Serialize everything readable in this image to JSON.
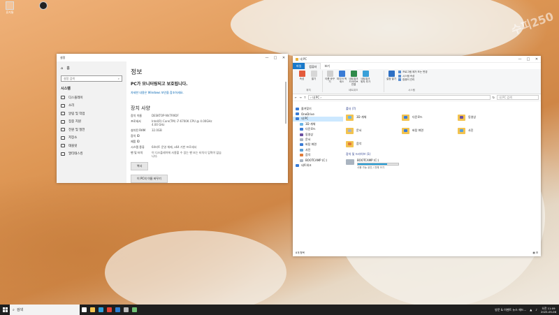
{
  "colors": {
    "accent": "#0063b1",
    "file_tab": "#1979ca",
    "folder": "#f3c34f",
    "selected_nav": "#cce8ff",
    "drive_fill": "#26a0da",
    "taskbar": "#1f1f1f"
  },
  "desktop": {
    "icons": [
      {
        "label": "휴지통",
        "icon": "recycle-bin-icon"
      },
      {
        "label": "",
        "icon": "app-shortcut-icon"
      }
    ],
    "watermark": "수피250"
  },
  "settings": {
    "window_title": "설정",
    "controls": [
      "—",
      "□",
      "✕"
    ],
    "home_label": "홈",
    "search_placeholder": "설정 검색",
    "category": "시스템",
    "nav_items": [
      {
        "label": "디스플레이",
        "icon": "display-icon"
      },
      {
        "label": "소리",
        "icon": "sound-icon"
      },
      {
        "label": "알림 및 작업",
        "icon": "notification-icon"
      },
      {
        "label": "집중 지원",
        "icon": "focus-assist-icon"
      },
      {
        "label": "전원 및 절전",
        "icon": "power-icon"
      },
      {
        "label": "저장소",
        "icon": "storage-icon"
      },
      {
        "label": "태블릿",
        "icon": "tablet-icon"
      },
      {
        "label": "멀티태스킹",
        "icon": "multitasking-icon"
      }
    ],
    "page_title": "정보",
    "protect_status": "PC가 모니터링되고 보호됩니다.",
    "security_link": "자세한 내용은 Windows 보안을 참조하세요.",
    "device_heading": "장치 사양",
    "specs": [
      {
        "key": "장치 이름",
        "value": "DESKTOP-NV7R9DF"
      },
      {
        "key": "프로세서",
        "value": "Intel(R) Core(TM) i7-6700K CPU @ 4.00GHz   4.00 GHz"
      },
      {
        "key": "설치된 RAM",
        "value": "32.0GB"
      },
      {
        "key": "장치 ID",
        "value": ""
      },
      {
        "key": "제품 ID",
        "value": ""
      },
      {
        "key": "시스템 종류",
        "value": "64비트 운영 체제, x64 기반 프로세서"
      },
      {
        "key": "펜 및 터치",
        "value": "이 디스플레이에 사용할 수 있는 펜 또는 터치식 입력이 없습니다."
      }
    ],
    "copy_button": "복사",
    "rename_button": "이 PC의 이름 바꾸기"
  },
  "explorer": {
    "window_title": "내 PC",
    "controls": [
      "—",
      "□",
      "✕"
    ],
    "tabs": [
      "파일",
      "컴퓨터",
      "보기"
    ],
    "ribbon": {
      "groups": [
        {
          "label": "위치",
          "buttons": [
            {
              "label": "속성",
              "icon": "properties-icon"
            },
            {
              "label": "열기",
              "icon": "open-icon"
            },
            {
              "label": "이름 바꾸기",
              "icon": "rename-icon"
            },
            {
              "label": "미디어 액세스",
              "icon": "media-access-icon"
            },
            {
              "label": "네트워크 드라이브 연결",
              "icon": "map-network-drive-icon"
            },
            {
              "label": "네트워크 위치 추가",
              "icon": "add-network-location-icon"
            }
          ]
        },
        {
          "label": "네트워크",
          "buttons": []
        },
        {
          "label": "시스템",
          "buttons": [
            {
              "label": "설정 열기",
              "icon": "open-settings-icon"
            }
          ]
        }
      ],
      "system_list": [
        "프로그램 제거 또는 변경",
        "시스템 속성",
        "컴퓨터 관리"
      ]
    },
    "address": "› 내 PC ›",
    "search_placeholder": "내 PC 검색",
    "nav": [
      {
        "label": "즐겨찾기",
        "icon": "star-icon",
        "color": "#3a7bd5",
        "sub": false,
        "selected": false
      },
      {
        "label": "OneDrive",
        "icon": "cloud-icon",
        "color": "#3a7bd5",
        "sub": false,
        "selected": false
      },
      {
        "label": "내 PC",
        "icon": "pc-icon",
        "color": "#3a7bd5",
        "sub": false,
        "selected": true
      },
      {
        "label": "3D 개체",
        "icon": "3d-objects-icon",
        "color": "#6cb6e8",
        "sub": true,
        "selected": false
      },
      {
        "label": "다운로드",
        "icon": "download-icon",
        "color": "#3a7bd5",
        "sub": true,
        "selected": false
      },
      {
        "label": "동영상",
        "icon": "video-icon",
        "color": "#6b4fa0",
        "sub": true,
        "selected": false
      },
      {
        "label": "문서",
        "icon": "document-icon",
        "color": "#aab4c0",
        "sub": true,
        "selected": false
      },
      {
        "label": "바탕 화면",
        "icon": "desktop-icon",
        "color": "#3a7bd5",
        "sub": true,
        "selected": false
      },
      {
        "label": "사진",
        "icon": "pictures-icon",
        "color": "#5aa0d8",
        "sub": true,
        "selected": false
      },
      {
        "label": "음악",
        "icon": "music-icon",
        "color": "#e07b39",
        "sub": true,
        "selected": false
      },
      {
        "label": "BOOTCAMP (C:)",
        "icon": "drive-icon",
        "color": "#aab4c0",
        "sub": true,
        "selected": false
      },
      {
        "label": "네트워크",
        "icon": "network-icon",
        "color": "#3a7bd5",
        "sub": false,
        "selected": false
      }
    ],
    "folders_header": "폴더 (7)",
    "folders": [
      {
        "label": "3D 개체",
        "overlay": "#6cb6e8"
      },
      {
        "label": "다운로드",
        "overlay": "#3a7bd5"
      },
      {
        "label": "동영상",
        "overlay": "#6b4fa0"
      },
      {
        "label": "문서",
        "overlay": "#aab4c0"
      },
      {
        "label": "바탕 화면",
        "overlay": "#3a7bd5"
      },
      {
        "label": "사진",
        "overlay": "#5aa0d8"
      },
      {
        "label": "음악",
        "overlay": "#e07b39"
      }
    ],
    "drives_header": "장치 및 드라이브 (1)",
    "drive": {
      "name": "BOOTCAMP (C:)",
      "used_fraction": 0.72,
      "free_text": "사용 가능 공간 / 전체 크기"
    },
    "status": "8개 항목"
  },
  "taskbar": {
    "search_placeholder": "검색",
    "apps": [
      {
        "icon": "task-view-icon",
        "color": "#ffffff"
      },
      {
        "icon": "file-explorer-icon",
        "color": "#f3c34f"
      },
      {
        "icon": "edge-icon",
        "color": "#2f9ed9"
      },
      {
        "icon": "chrome-icon",
        "color": "#e34133"
      },
      {
        "icon": "store-icon",
        "color": "#2d7dd2"
      },
      {
        "icon": "settings-icon",
        "color": "#bbbbbb"
      },
      {
        "icon": "app-icon",
        "color": "#6fbf73"
      }
    ],
    "tray_text": "방문 & 이벤트 뉴스 헤드...",
    "time": "오전 11:09",
    "date": "2025-05-06"
  }
}
